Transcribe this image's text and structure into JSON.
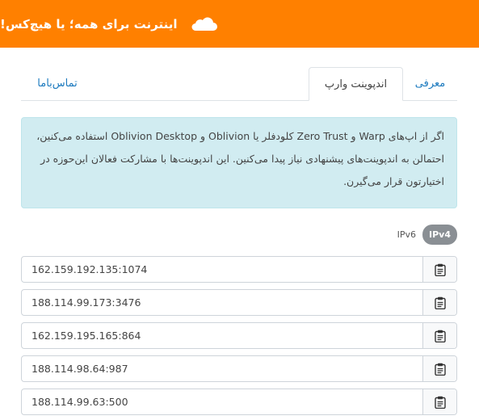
{
  "header": {
    "title": "اینترنت برای همه؛ یا هیچ‌کس!",
    "logo_icon": "cloud-icon",
    "background_color": "#ff8000"
  },
  "tabs": [
    {
      "label": "معرفی",
      "active": false
    },
    {
      "label": "اندپوینت وارپ",
      "active": true
    },
    {
      "label": "تماس‌باما",
      "active": false
    }
  ],
  "info": {
    "text": "اگر از اپ‌های Warp و Zero Trust کلودفلر یا Oblivion و Oblivion Desktop استفاده می‌کنین، احتمالن به اندپوینت‌های پیشنهادی نیاز پیدا می‌کنین. این اندپوینت‌ها با مشارکت فعالان این‌حوزه در اختیارتون قرار می‌گیرن."
  },
  "ip_toggle": {
    "active": "IPv4",
    "inactive": "IPv6"
  },
  "endpoints": [
    {
      "value": "162.159.192.135:1074",
      "icon": "clipboard-icon"
    },
    {
      "value": "188.114.99.173:3476",
      "icon": "clipboard-icon"
    },
    {
      "value": "162.159.195.165:864",
      "icon": "clipboard-icon"
    },
    {
      "value": "188.114.98.64:987",
      "icon": "clipboard-icon"
    },
    {
      "value": "188.114.99.63:500",
      "icon": "clipboard-icon"
    }
  ]
}
